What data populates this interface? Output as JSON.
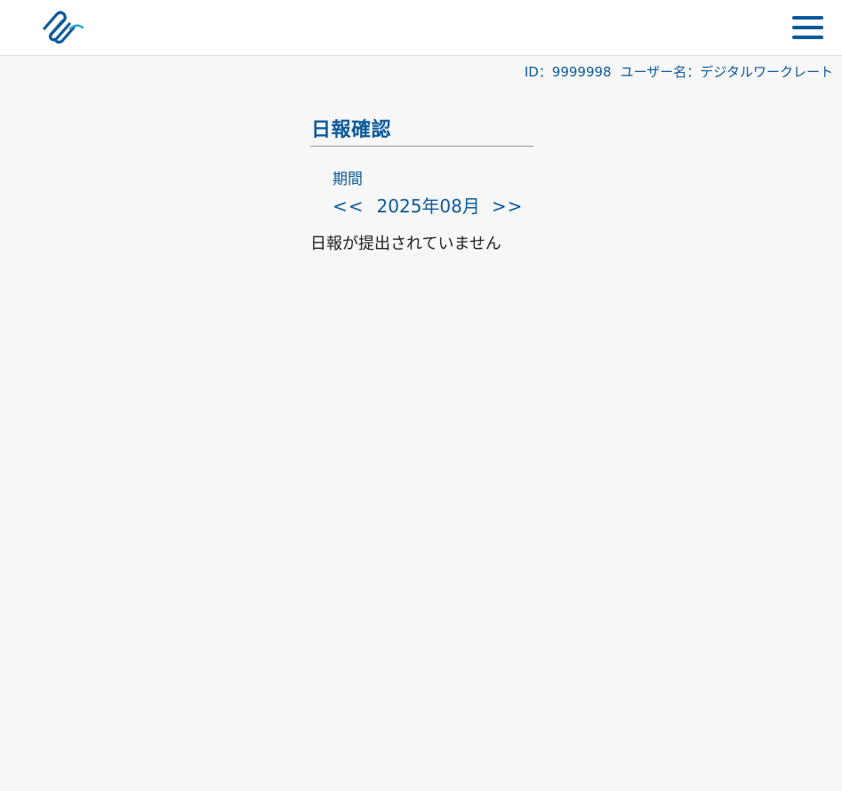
{
  "header": {
    "logo_icon": "paperclip-wave-logo",
    "menu_icon": "hamburger-menu-icon",
    "brand_color": "#0b5a9c",
    "accent_color": "#2aa6d8"
  },
  "user": {
    "id_text": "ID：9999998",
    "name_text": "ユーザー名：デジタルワークレート"
  },
  "main": {
    "title": "日報確認",
    "period_label": "期間",
    "prev_label": "<<",
    "period_value": "2025年08月",
    "next_label": ">>",
    "empty_message": "日報が提出されていません"
  }
}
